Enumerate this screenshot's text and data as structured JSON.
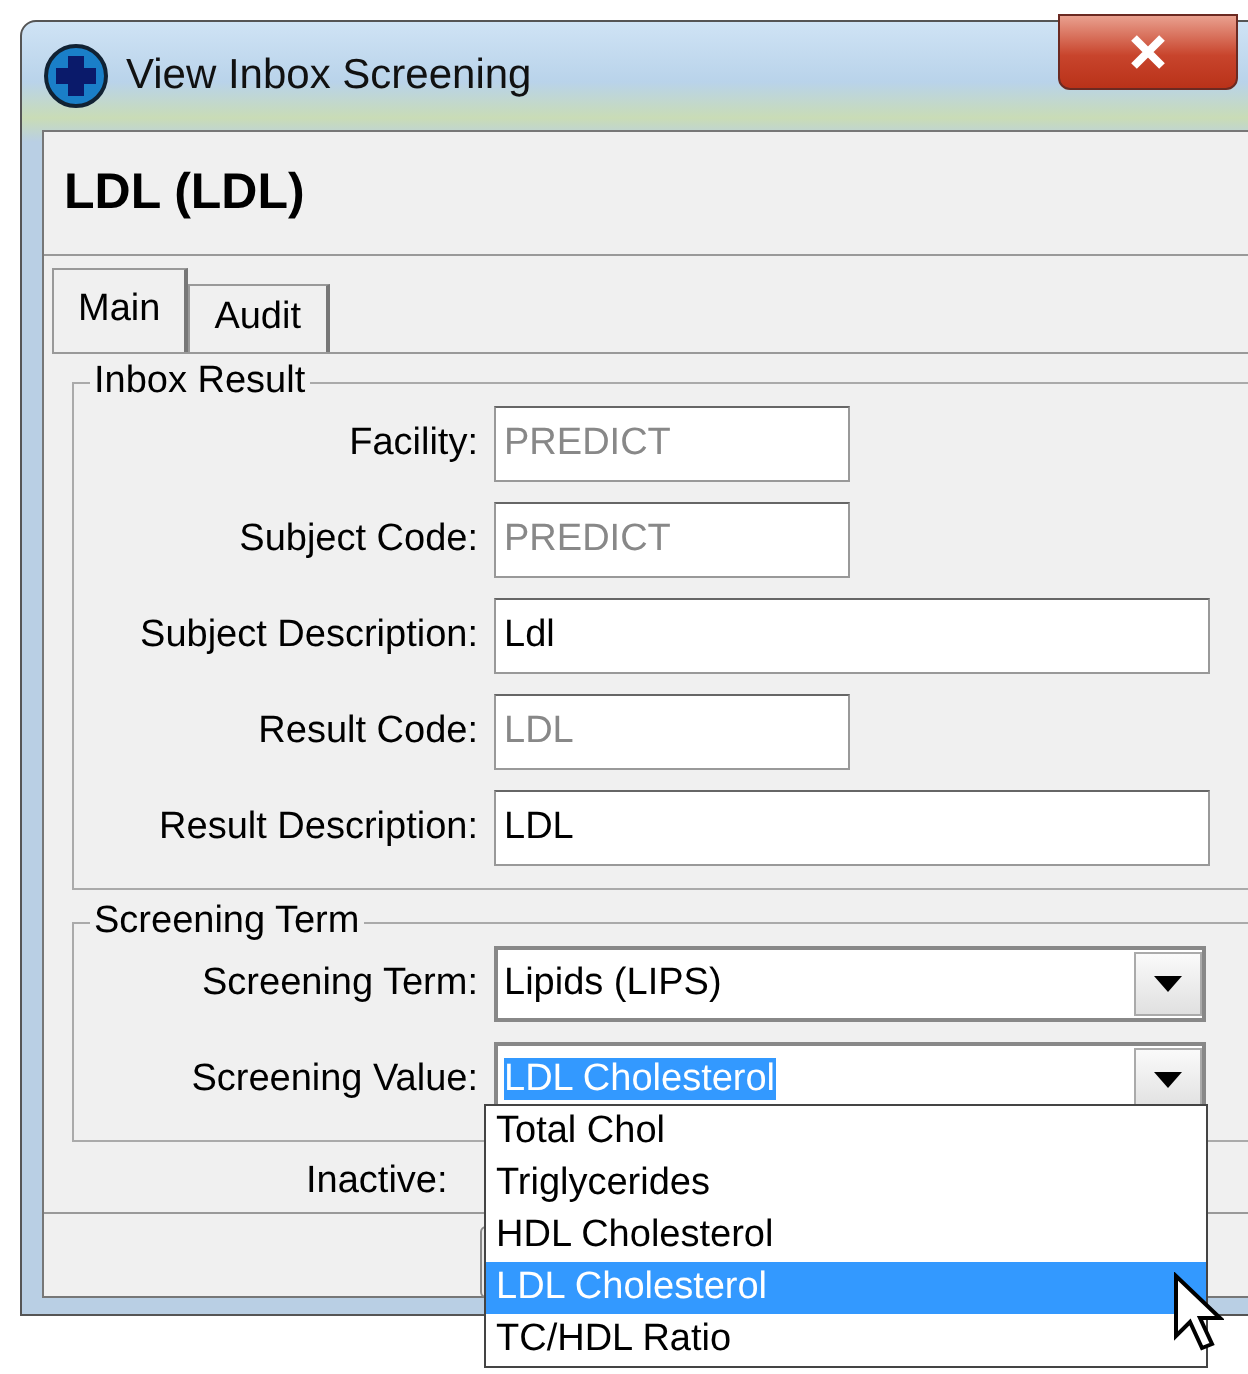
{
  "window": {
    "title": "View Inbox Screening"
  },
  "heading": "LDL (LDL)",
  "tabs": [
    {
      "label": "Main",
      "selected": true
    },
    {
      "label": "Audit",
      "selected": false
    }
  ],
  "inbox_result": {
    "title": "Inbox Result",
    "fields": [
      {
        "label": "Facility:",
        "value": "PREDICT",
        "disabled": true
      },
      {
        "label": "Subject Code:",
        "value": "PREDICT",
        "disabled": true
      },
      {
        "label": "Subject Description:",
        "value": "Ldl",
        "disabled": false
      },
      {
        "label": "Result Code:",
        "value": "LDL",
        "disabled": true
      },
      {
        "label": "Result Description:",
        "value": "LDL",
        "disabled": false
      }
    ]
  },
  "screening_term": {
    "title": "Screening Term",
    "fields": [
      {
        "label": "Screening Term:",
        "value": "Lipids (LIPS)",
        "highlighted": false
      },
      {
        "label": "Screening Value:",
        "value": "LDL Cholesterol",
        "highlighted": true
      }
    ]
  },
  "inactive_label": "Inactive:",
  "dropdown": {
    "options": [
      {
        "label": "Total Chol",
        "selected": false
      },
      {
        "label": "Triglycerides",
        "selected": false
      },
      {
        "label": "HDL Cholesterol",
        "selected": false
      },
      {
        "label": "LDL Cholesterol",
        "selected": true
      },
      {
        "label": "TC/HDL Ratio",
        "selected": false
      }
    ]
  }
}
